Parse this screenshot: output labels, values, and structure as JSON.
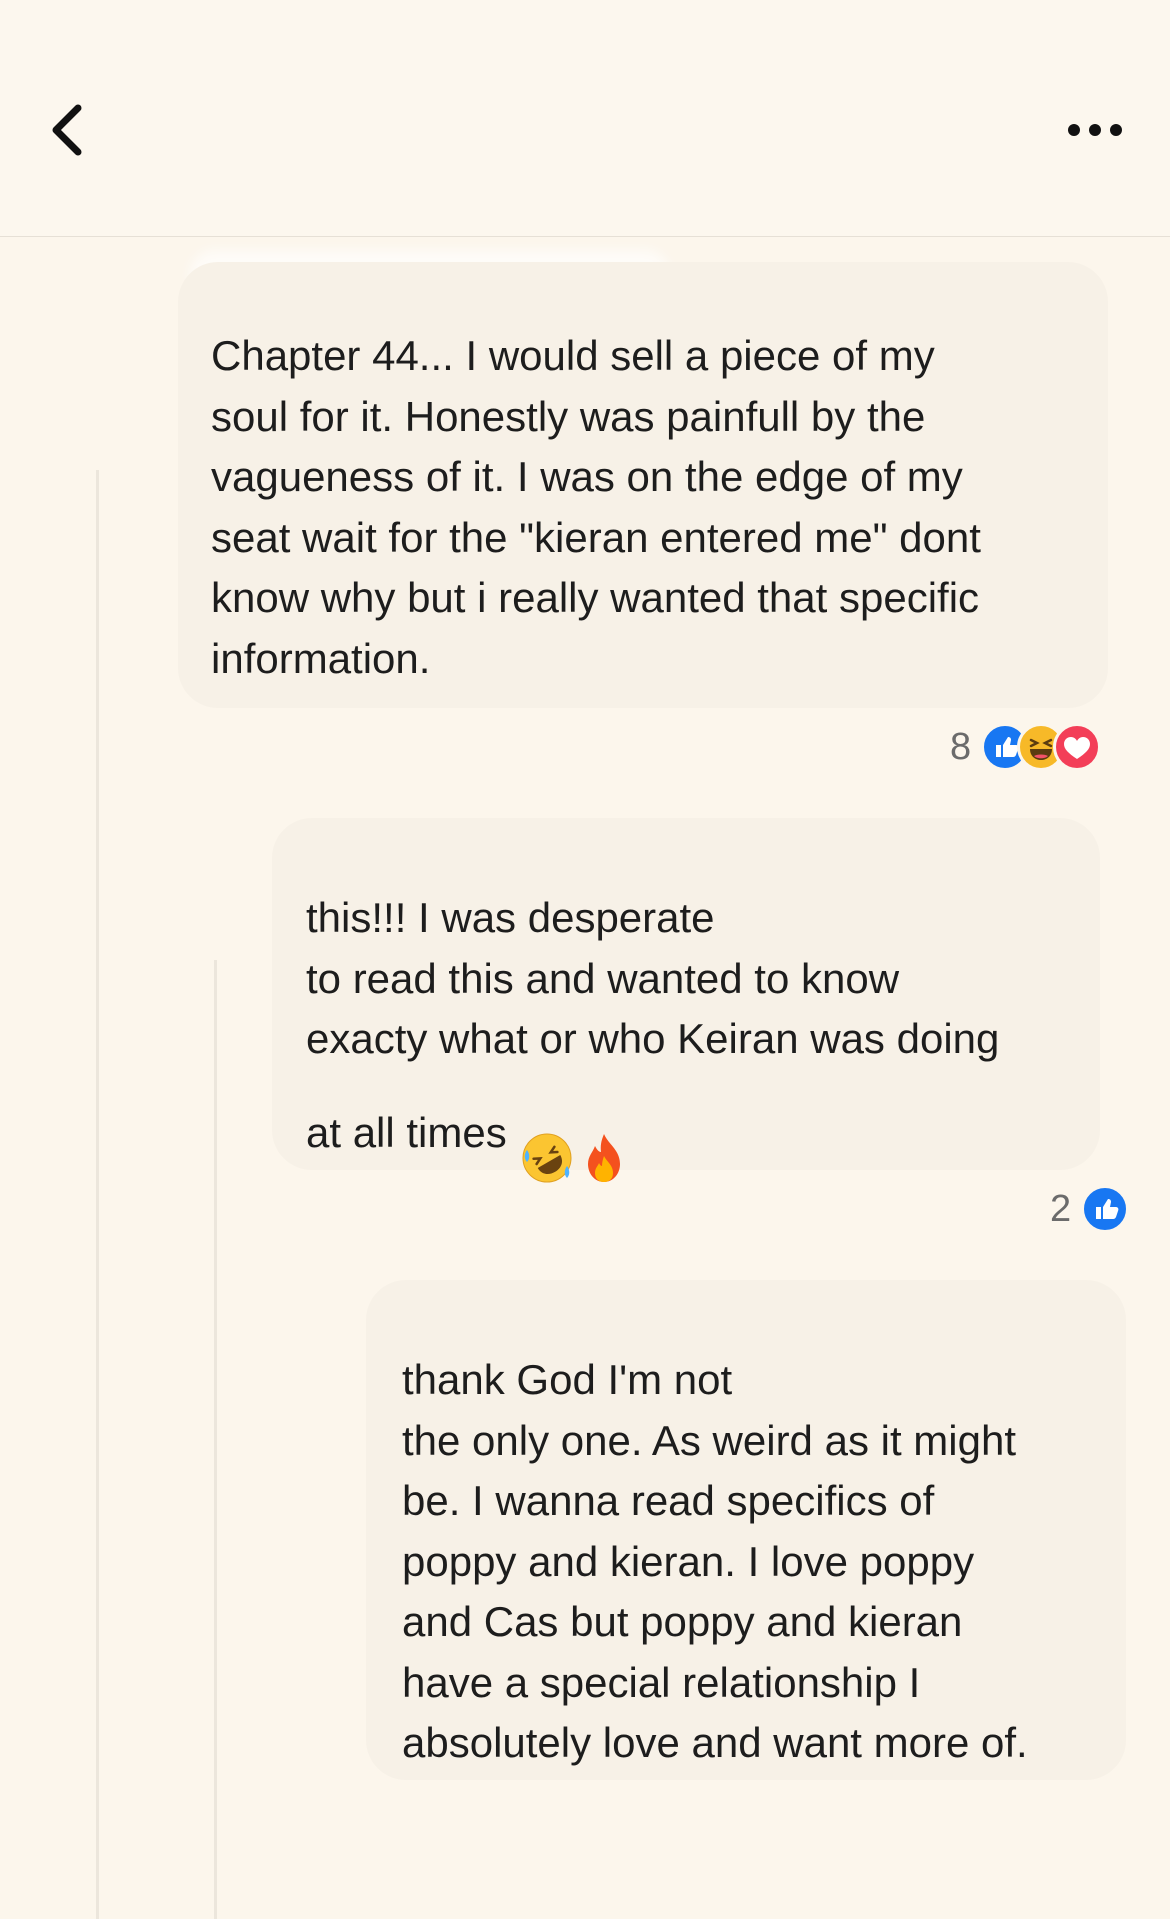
{
  "header": {
    "back_icon": "chevron-left-icon",
    "more_icon": "more-horizontal-icon"
  },
  "comments": [
    {
      "text": "Chapter 44... I would sell a piece of my\nsoul for it. Honestly was painfull by the\nvagueness of it. I was on the edge of my\nseat wait for the \"kieran entered me\" dont\nknow why but i really wanted that specific\ninformation.",
      "reaction_count": "8",
      "reactions": [
        "like",
        "haha",
        "love"
      ]
    },
    {
      "text": "this!!! I was desperate\nto read this and wanted to know\nexacty what or who Keiran was doing\nat all times",
      "emojis": [
        "rolling-on-floor-laughing",
        "fire"
      ],
      "reaction_count": "2",
      "reactions": [
        "like"
      ]
    },
    {
      "text": "thank God I'm not\nthe only one. As weird as it might\nbe. I wanna read specifics of\npoppy and kieran. I love poppy\nand Cas but poppy and kieran\nhave a special relationship I\nabsolutely love and want more of."
    }
  ],
  "colors": {
    "background": "#fcf6ec",
    "bubble": "#f7f1e7",
    "like_blue": "#1877f2",
    "love_red": "#f33e58",
    "haha_yellow": "#f7b928"
  }
}
